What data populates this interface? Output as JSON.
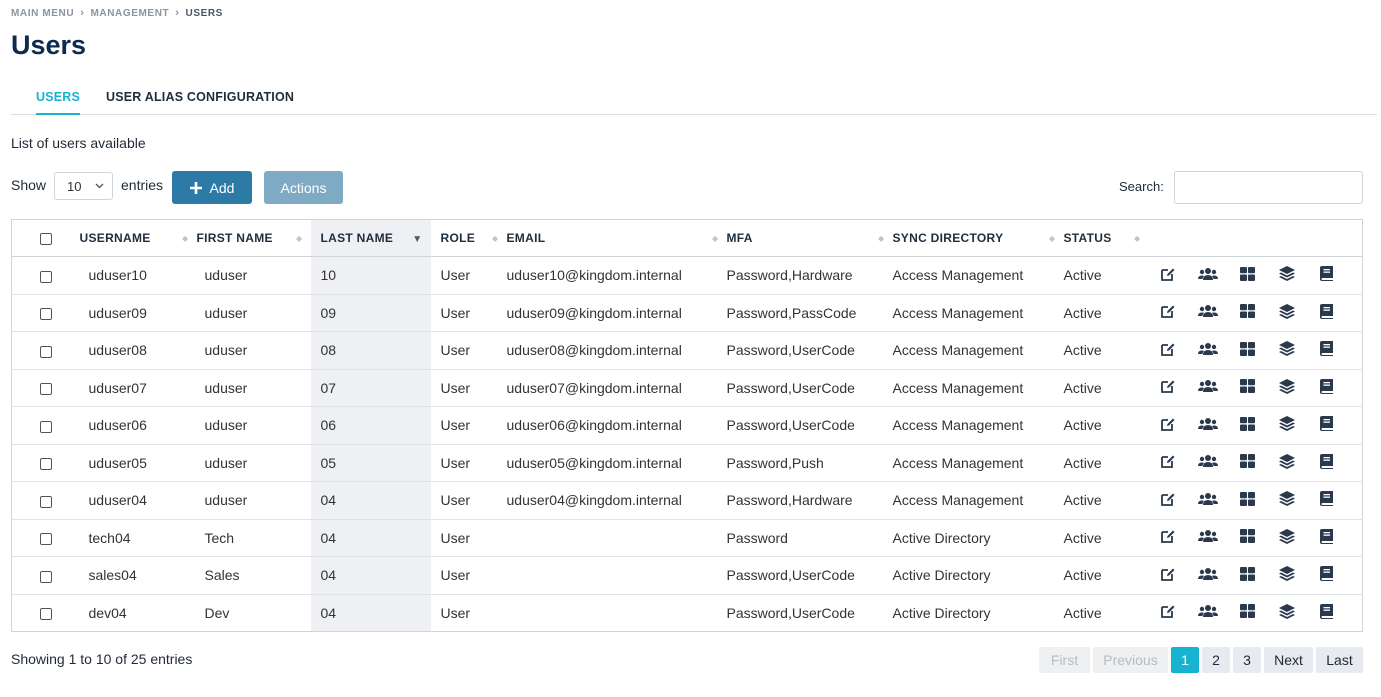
{
  "breadcrumb": [
    "MAIN MENU",
    "MANAGEMENT",
    "USERS"
  ],
  "page_title": "Users",
  "tabs": [
    {
      "label": "USERS",
      "active": true
    },
    {
      "label": "USER ALIAS CONFIGURATION",
      "active": false
    }
  ],
  "list_description": "List of users available",
  "controls": {
    "show_label": "Show",
    "entries_value": "10",
    "entries_label": "entries",
    "add_label": "Add",
    "actions_label": "Actions",
    "search_label": "Search:",
    "search_value": ""
  },
  "table": {
    "columns": [
      "USERNAME",
      "FIRST NAME",
      "LAST NAME",
      "ROLE",
      "EMAIL",
      "MFA",
      "SYNC DIRECTORY",
      "STATUS"
    ],
    "sorted_column": "LAST NAME",
    "sort_direction": "desc",
    "row_actions": [
      "edit-icon",
      "users-group-icon",
      "grid-icon",
      "layers-icon",
      "book-icon"
    ],
    "rows": [
      {
        "username": "uduser10",
        "first_name": "uduser",
        "last_name": "10",
        "role": "User",
        "email": "uduser10@kingdom.internal",
        "mfa": "Password,Hardware",
        "sync_directory": "Access Management",
        "status": "Active"
      },
      {
        "username": "uduser09",
        "first_name": "uduser",
        "last_name": "09",
        "role": "User",
        "email": "uduser09@kingdom.internal",
        "mfa": "Password,PassCode",
        "sync_directory": "Access Management",
        "status": "Active"
      },
      {
        "username": "uduser08",
        "first_name": "uduser",
        "last_name": "08",
        "role": "User",
        "email": "uduser08@kingdom.internal",
        "mfa": "Password,UserCode",
        "sync_directory": "Access Management",
        "status": "Active"
      },
      {
        "username": "uduser07",
        "first_name": "uduser",
        "last_name": "07",
        "role": "User",
        "email": "uduser07@kingdom.internal",
        "mfa": "Password,UserCode",
        "sync_directory": "Access Management",
        "status": "Active"
      },
      {
        "username": "uduser06",
        "first_name": "uduser",
        "last_name": "06",
        "role": "User",
        "email": "uduser06@kingdom.internal",
        "mfa": "Password,UserCode",
        "sync_directory": "Access Management",
        "status": "Active"
      },
      {
        "username": "uduser05",
        "first_name": "uduser",
        "last_name": "05",
        "role": "User",
        "email": "uduser05@kingdom.internal",
        "mfa": "Password,Push",
        "sync_directory": "Access Management",
        "status": "Active"
      },
      {
        "username": "uduser04",
        "first_name": "uduser",
        "last_name": "04",
        "role": "User",
        "email": "uduser04@kingdom.internal",
        "mfa": "Password,Hardware",
        "sync_directory": "Access Management",
        "status": "Active"
      },
      {
        "username": "tech04",
        "first_name": "Tech",
        "last_name": "04",
        "role": "User",
        "email": "",
        "mfa": "Password",
        "sync_directory": "Active Directory",
        "status": "Active"
      },
      {
        "username": "sales04",
        "first_name": "Sales",
        "last_name": "04",
        "role": "User",
        "email": "",
        "mfa": "Password,UserCode",
        "sync_directory": "Active Directory",
        "status": "Active"
      },
      {
        "username": "dev04",
        "first_name": "Dev",
        "last_name": "04",
        "role": "User",
        "email": "",
        "mfa": "Password,UserCode",
        "sync_directory": "Active Directory",
        "status": "Active"
      }
    ]
  },
  "footer": {
    "info": "Showing 1 to 10 of 25 entries",
    "pagination": {
      "first": "First",
      "previous": "Previous",
      "pages": [
        "1",
        "2",
        "3"
      ],
      "current_page": "1",
      "next": "Next",
      "last": "Last"
    }
  },
  "colors": {
    "accent": "#17b3d1",
    "primary_button": "#2b7ba6",
    "secondary_button": "#7eaac4",
    "title": "#0d2a4f",
    "icon": "#2a3a4c"
  }
}
